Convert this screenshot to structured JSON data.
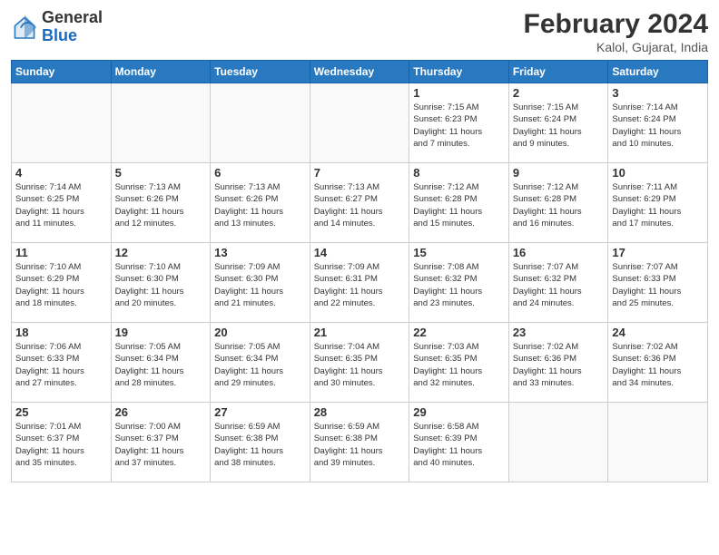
{
  "header": {
    "logo_general": "General",
    "logo_blue": "Blue",
    "title": "February 2024",
    "subtitle": "Kalol, Gujarat, India"
  },
  "days_of_week": [
    "Sunday",
    "Monday",
    "Tuesday",
    "Wednesday",
    "Thursday",
    "Friday",
    "Saturday"
  ],
  "weeks": [
    [
      {
        "day": "",
        "info": ""
      },
      {
        "day": "",
        "info": ""
      },
      {
        "day": "",
        "info": ""
      },
      {
        "day": "",
        "info": ""
      },
      {
        "day": "1",
        "info": "Sunrise: 7:15 AM\nSunset: 6:23 PM\nDaylight: 11 hours\nand 7 minutes."
      },
      {
        "day": "2",
        "info": "Sunrise: 7:15 AM\nSunset: 6:24 PM\nDaylight: 11 hours\nand 9 minutes."
      },
      {
        "day": "3",
        "info": "Sunrise: 7:14 AM\nSunset: 6:24 PM\nDaylight: 11 hours\nand 10 minutes."
      }
    ],
    [
      {
        "day": "4",
        "info": "Sunrise: 7:14 AM\nSunset: 6:25 PM\nDaylight: 11 hours\nand 11 minutes."
      },
      {
        "day": "5",
        "info": "Sunrise: 7:13 AM\nSunset: 6:26 PM\nDaylight: 11 hours\nand 12 minutes."
      },
      {
        "day": "6",
        "info": "Sunrise: 7:13 AM\nSunset: 6:26 PM\nDaylight: 11 hours\nand 13 minutes."
      },
      {
        "day": "7",
        "info": "Sunrise: 7:13 AM\nSunset: 6:27 PM\nDaylight: 11 hours\nand 14 minutes."
      },
      {
        "day": "8",
        "info": "Sunrise: 7:12 AM\nSunset: 6:28 PM\nDaylight: 11 hours\nand 15 minutes."
      },
      {
        "day": "9",
        "info": "Sunrise: 7:12 AM\nSunset: 6:28 PM\nDaylight: 11 hours\nand 16 minutes."
      },
      {
        "day": "10",
        "info": "Sunrise: 7:11 AM\nSunset: 6:29 PM\nDaylight: 11 hours\nand 17 minutes."
      }
    ],
    [
      {
        "day": "11",
        "info": "Sunrise: 7:10 AM\nSunset: 6:29 PM\nDaylight: 11 hours\nand 18 minutes."
      },
      {
        "day": "12",
        "info": "Sunrise: 7:10 AM\nSunset: 6:30 PM\nDaylight: 11 hours\nand 20 minutes."
      },
      {
        "day": "13",
        "info": "Sunrise: 7:09 AM\nSunset: 6:30 PM\nDaylight: 11 hours\nand 21 minutes."
      },
      {
        "day": "14",
        "info": "Sunrise: 7:09 AM\nSunset: 6:31 PM\nDaylight: 11 hours\nand 22 minutes."
      },
      {
        "day": "15",
        "info": "Sunrise: 7:08 AM\nSunset: 6:32 PM\nDaylight: 11 hours\nand 23 minutes."
      },
      {
        "day": "16",
        "info": "Sunrise: 7:07 AM\nSunset: 6:32 PM\nDaylight: 11 hours\nand 24 minutes."
      },
      {
        "day": "17",
        "info": "Sunrise: 7:07 AM\nSunset: 6:33 PM\nDaylight: 11 hours\nand 25 minutes."
      }
    ],
    [
      {
        "day": "18",
        "info": "Sunrise: 7:06 AM\nSunset: 6:33 PM\nDaylight: 11 hours\nand 27 minutes."
      },
      {
        "day": "19",
        "info": "Sunrise: 7:05 AM\nSunset: 6:34 PM\nDaylight: 11 hours\nand 28 minutes."
      },
      {
        "day": "20",
        "info": "Sunrise: 7:05 AM\nSunset: 6:34 PM\nDaylight: 11 hours\nand 29 minutes."
      },
      {
        "day": "21",
        "info": "Sunrise: 7:04 AM\nSunset: 6:35 PM\nDaylight: 11 hours\nand 30 minutes."
      },
      {
        "day": "22",
        "info": "Sunrise: 7:03 AM\nSunset: 6:35 PM\nDaylight: 11 hours\nand 32 minutes."
      },
      {
        "day": "23",
        "info": "Sunrise: 7:02 AM\nSunset: 6:36 PM\nDaylight: 11 hours\nand 33 minutes."
      },
      {
        "day": "24",
        "info": "Sunrise: 7:02 AM\nSunset: 6:36 PM\nDaylight: 11 hours\nand 34 minutes."
      }
    ],
    [
      {
        "day": "25",
        "info": "Sunrise: 7:01 AM\nSunset: 6:37 PM\nDaylight: 11 hours\nand 35 minutes."
      },
      {
        "day": "26",
        "info": "Sunrise: 7:00 AM\nSunset: 6:37 PM\nDaylight: 11 hours\nand 37 minutes."
      },
      {
        "day": "27",
        "info": "Sunrise: 6:59 AM\nSunset: 6:38 PM\nDaylight: 11 hours\nand 38 minutes."
      },
      {
        "day": "28",
        "info": "Sunrise: 6:59 AM\nSunset: 6:38 PM\nDaylight: 11 hours\nand 39 minutes."
      },
      {
        "day": "29",
        "info": "Sunrise: 6:58 AM\nSunset: 6:39 PM\nDaylight: 11 hours\nand 40 minutes."
      },
      {
        "day": "",
        "info": ""
      },
      {
        "day": "",
        "info": ""
      }
    ]
  ]
}
